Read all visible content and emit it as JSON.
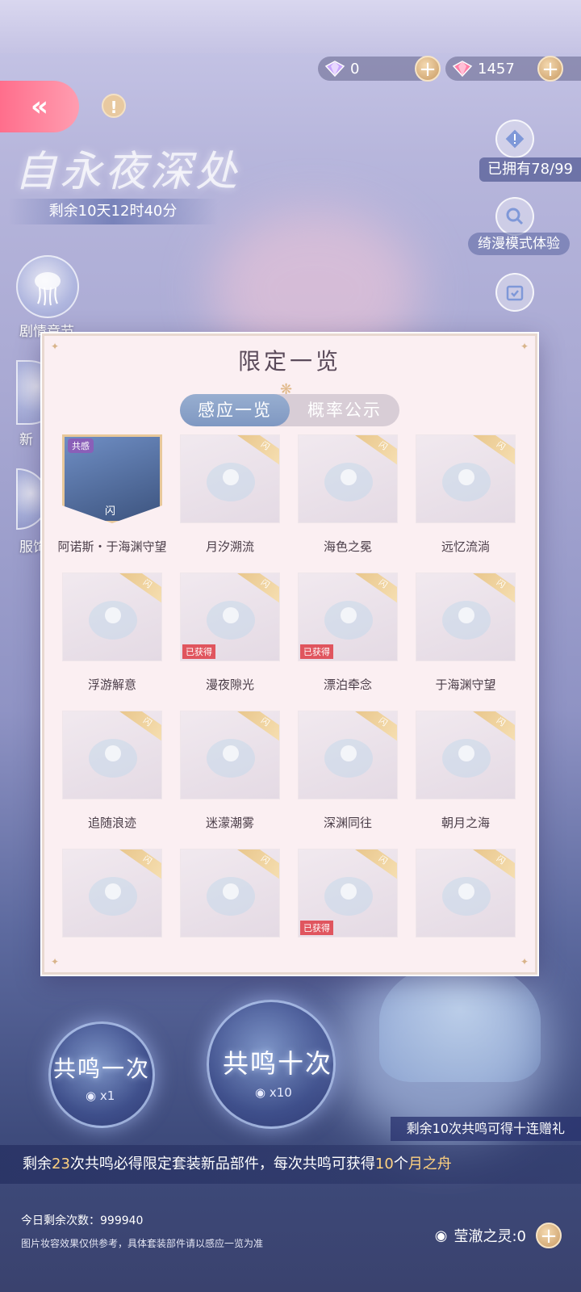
{
  "currency": {
    "premium_count": "0",
    "gem_count": "1457"
  },
  "event": {
    "title": "自永夜深处",
    "time_left": "剩余10天12时40分"
  },
  "side_menu": {
    "story_label": "剧情章节",
    "new_label": "新",
    "outfit_label": "服饰"
  },
  "right_panel": {
    "owned": "已拥有78/99",
    "preview_mode": "绮漫模式体验"
  },
  "dialog": {
    "title": "限定一览",
    "tabs": [
      "感应一览",
      "概率公示"
    ],
    "items": [
      {
        "name": "阿诺斯・于海渊守望",
        "tag": "共感",
        "rarity": "闪",
        "owned": false
      },
      {
        "name": "月汐溯流",
        "owned": false
      },
      {
        "name": "海色之冕",
        "owned": false
      },
      {
        "name": "远忆流淌",
        "owned": false
      },
      {
        "name": "浮游解意",
        "owned": false
      },
      {
        "name": "漫夜隙光",
        "owned": true
      },
      {
        "name": "漂泊牵念",
        "owned": true
      },
      {
        "name": "于海渊守望",
        "owned": false
      },
      {
        "name": "追随浪迹",
        "owned": false
      },
      {
        "name": "迷濛潮雾",
        "owned": false
      },
      {
        "name": "深渊同往",
        "owned": false
      },
      {
        "name": "朝月之海",
        "owned": false
      },
      {
        "name": "",
        "owned": false
      },
      {
        "name": "",
        "owned": false
      },
      {
        "name": "",
        "owned": true
      },
      {
        "name": "",
        "owned": false
      }
    ],
    "owned_label": "已获得",
    "ribbon_label": "闪"
  },
  "pull": {
    "once_label": "共鸣一次",
    "once_cost": "x1",
    "ten_label": "共鸣十次",
    "ten_cost": "x10",
    "bonus": "剩余10次共鸣可得十连赠礼"
  },
  "notice": {
    "prefix": "剩余",
    "count": "23",
    "mid": "次共鸣必得限定套装新品部件，每次共鸣可获得",
    "reward_count": "10",
    "reward_unit": "个",
    "reward_name": "月之舟"
  },
  "footer": {
    "daily_remaining": "今日剩余次数：999940",
    "disclaimer": "图片妆容效果仅供参考，具体套装部件请以感应一览为准",
    "spirit": "莹澈之灵:0"
  },
  "colors": {
    "accent_pink": "#ff7f98",
    "gold": "#e8c58a",
    "tab_active": "#8aa2c8",
    "owned_red": "#e0555e"
  }
}
